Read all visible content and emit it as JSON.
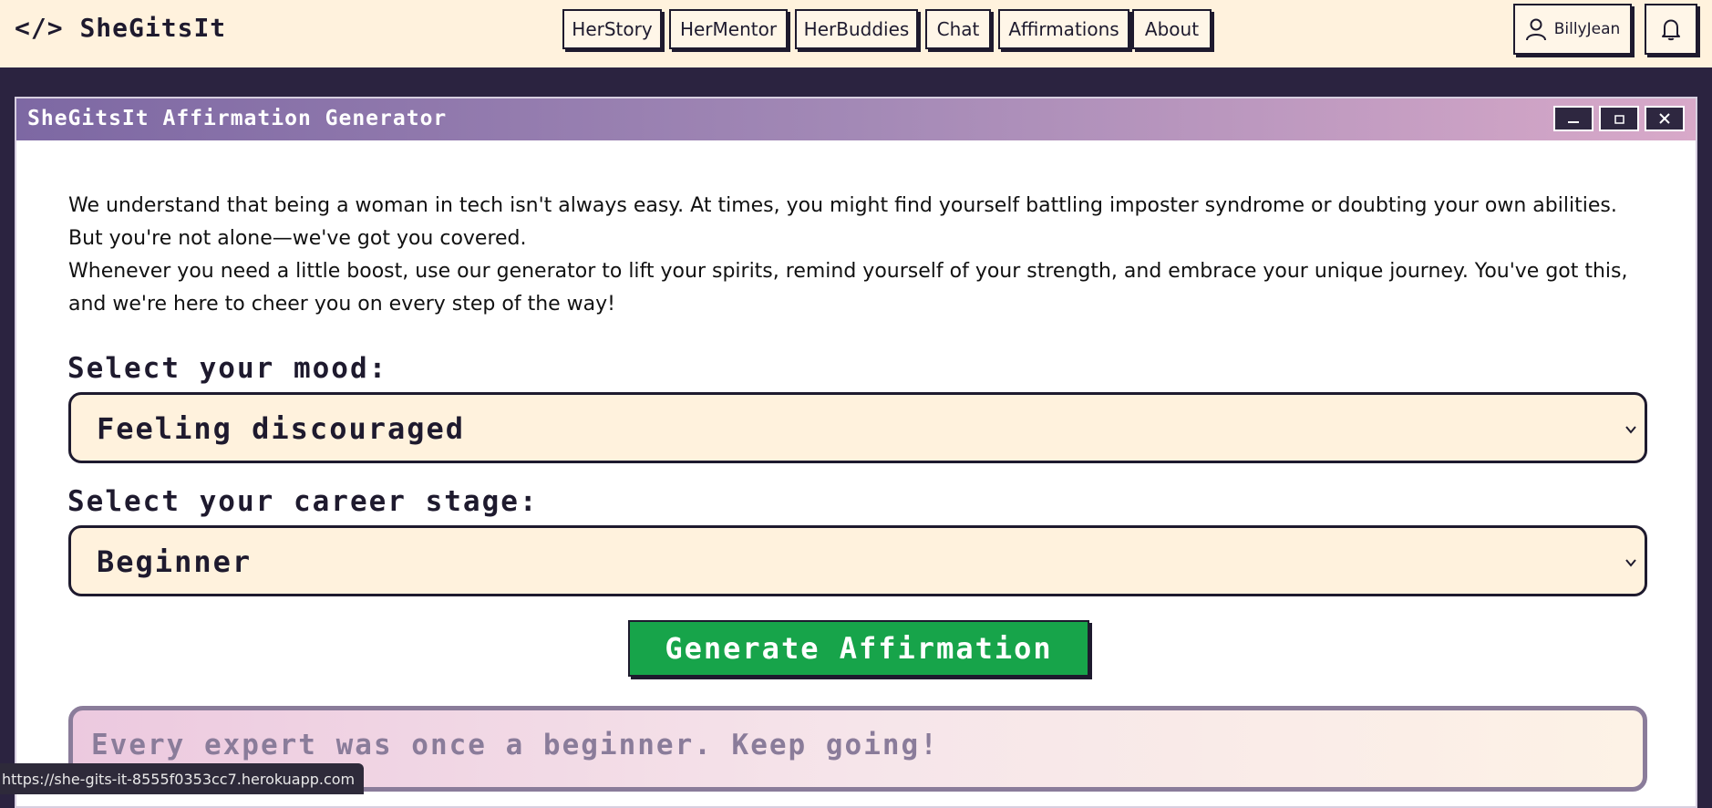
{
  "brand": {
    "icon": "</>",
    "name": "SheGitsIt"
  },
  "nav": {
    "links": [
      "HerStory",
      "HerMentor",
      "HerBuddies",
      "Chat",
      "Affirmations",
      "About"
    ],
    "user_label": "BillyJean",
    "user_icon": "person-icon",
    "bell_icon": "bell-icon"
  },
  "window": {
    "title": "SheGitsIt Affirmation Generator",
    "controls": [
      "minimize",
      "maximize",
      "close"
    ]
  },
  "intro": {
    "p1": "We understand that being a woman in tech isn't always easy. At times, you might find yourself battling imposter syndrome or doubting your own abilities. But you're not alone—we've got you covered.",
    "p2": "Whenever you need a little boost, use our generator to lift your spirits, remind yourself of your strength, and embrace your unique journey. You've got this, and we're here to cheer you on every step of the way!"
  },
  "form": {
    "mood_label": "Select your mood:",
    "mood_value": "Feeling discouraged",
    "stage_label": "Select your career stage:",
    "stage_value": "Beginner",
    "generate_label": "Generate Affirmation"
  },
  "result": {
    "text": "Every expert was once a beginner. Keep going!"
  },
  "status_bar": {
    "url": "https://she-gits-it-8555f0353cc7.herokuapp.com"
  },
  "colors": {
    "navbar_bg": "#fff2dd",
    "page_bg": "#2b2340",
    "accent_green": "#17a44a",
    "title_gradient_start": "#7d68a3",
    "title_gradient_end": "#d8a9c9",
    "ink": "#1e1a2e"
  }
}
